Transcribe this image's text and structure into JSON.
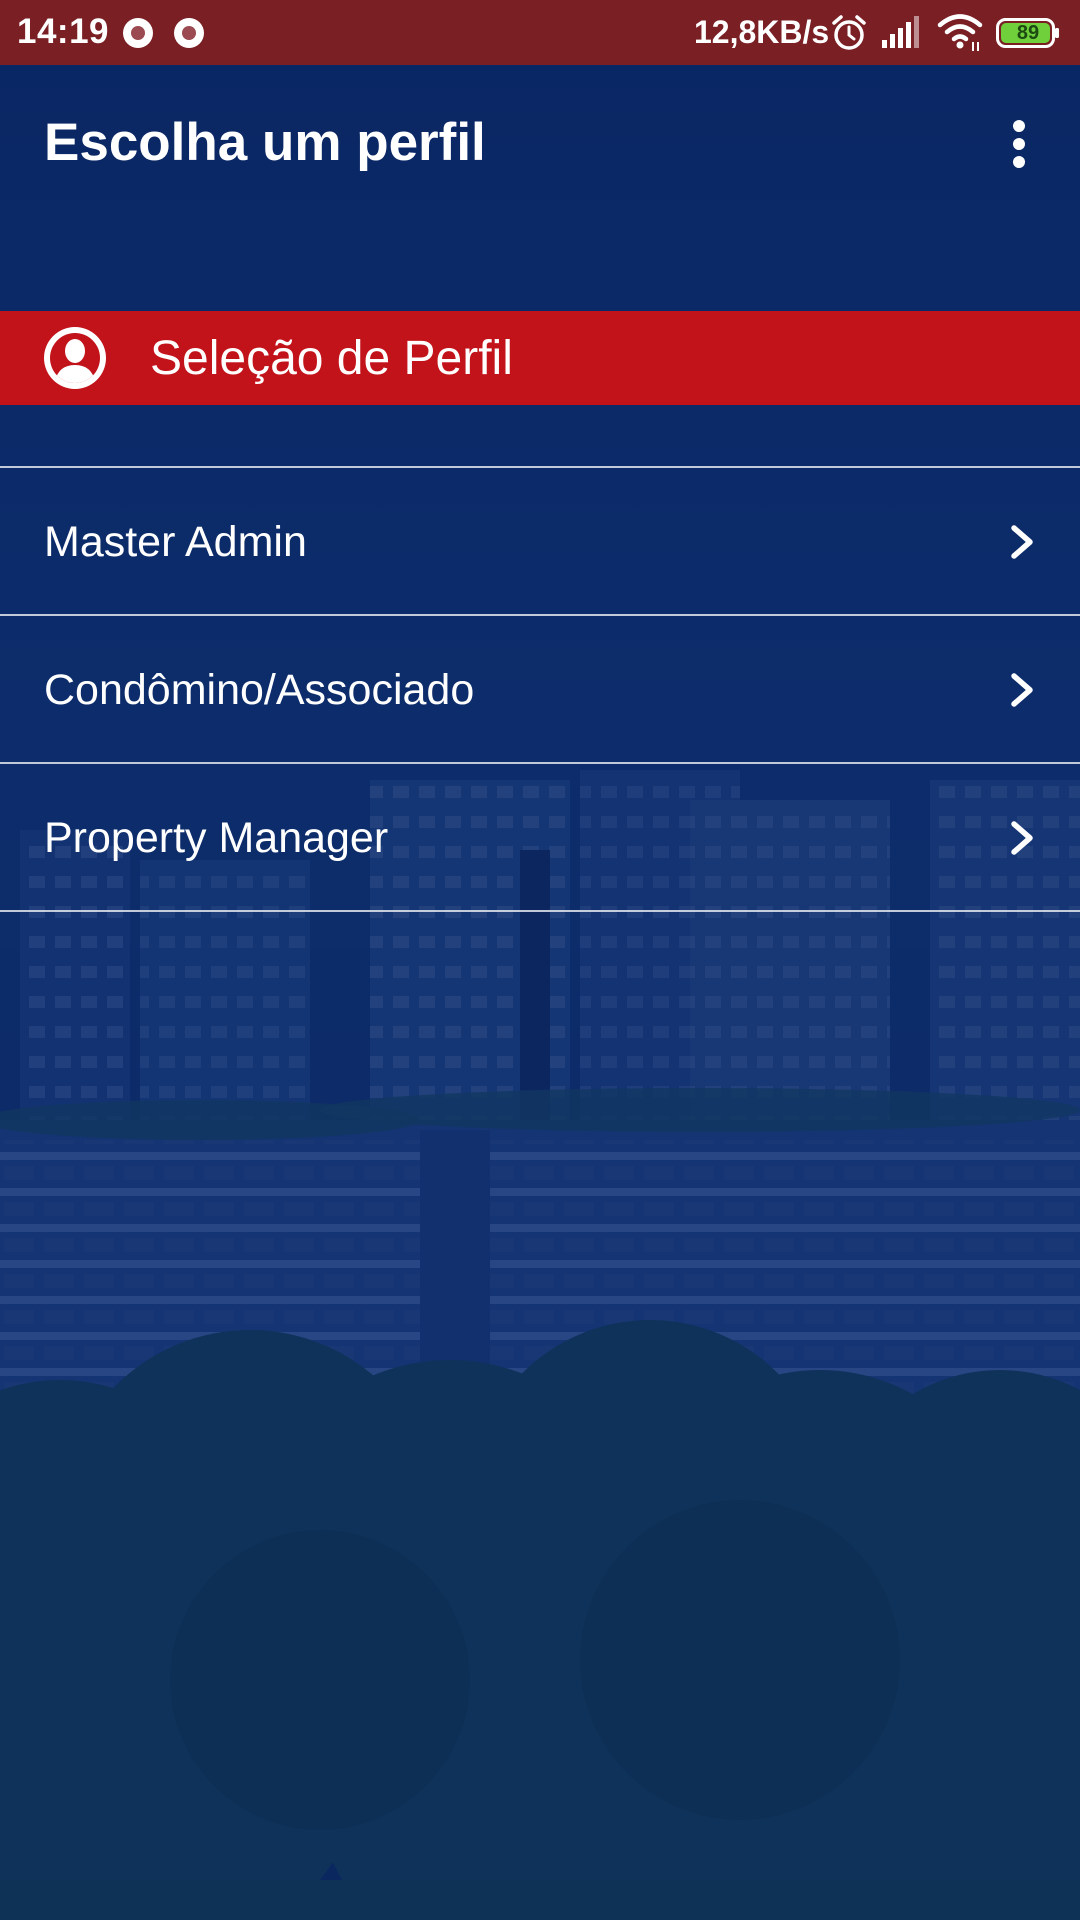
{
  "status_bar": {
    "time": "14:19",
    "network_speed": "12,8KB/s",
    "battery_level": "89",
    "icons": [
      "notification-dot-icon",
      "notification-dot-icon",
      "alarm-icon",
      "signal-icon",
      "wifi-icon",
      "battery-icon"
    ]
  },
  "app_bar": {
    "title": "Escolha um perfil",
    "menu_icon": "more-vert-icon"
  },
  "section": {
    "title": "Seleção de Perfil",
    "icon": "user-profile-icon"
  },
  "profiles": {
    "items": [
      {
        "label": "Master Admin",
        "icon": "chevron-right-icon"
      },
      {
        "label": "Condômino/Associado",
        "icon": "chevron-right-icon"
      },
      {
        "label": "Property Manager",
        "icon": "chevron-right-icon"
      }
    ]
  },
  "colors": {
    "status_bar": "#7a1f24",
    "background": "#0d2a66",
    "section_header": "#c2121a",
    "text": "#ffffff",
    "battery_fill": "#6fd03c"
  }
}
